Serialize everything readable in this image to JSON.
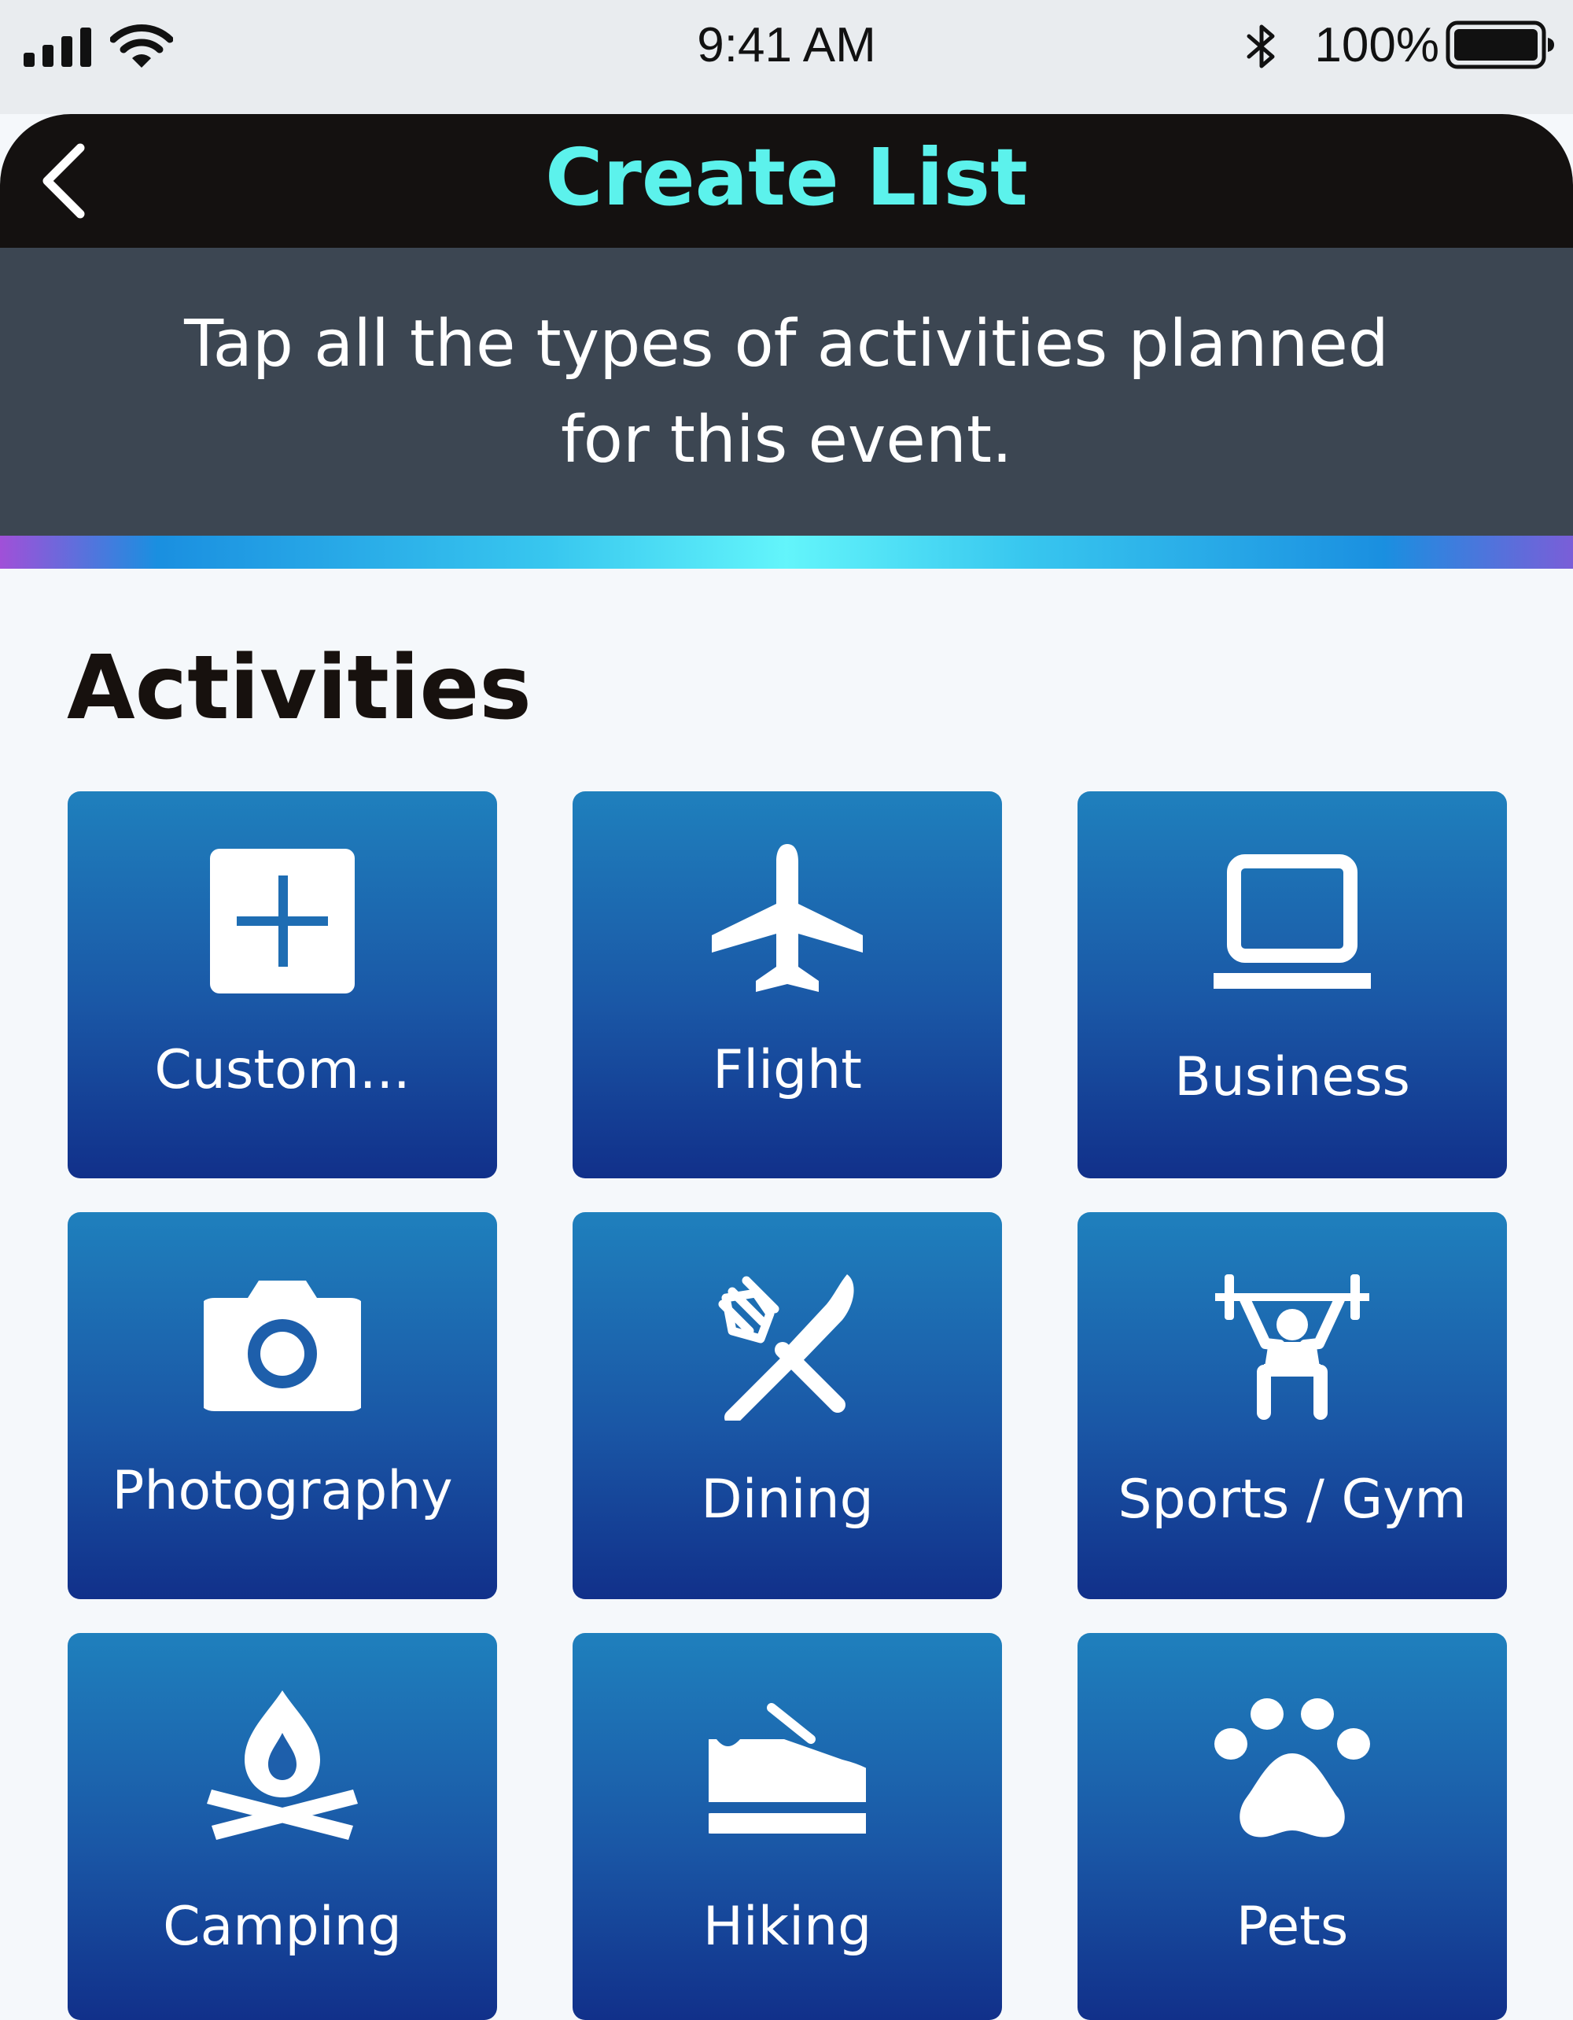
{
  "status_bar": {
    "time": "9:41 AM",
    "battery_percent": "100%",
    "icons": [
      "signal-icon",
      "wifi-icon",
      "bluetooth-icon",
      "battery-icon"
    ]
  },
  "nav": {
    "title": "Create List",
    "back_icon": "chevron-left-icon"
  },
  "instruction": {
    "line1": "Tap all the types of activities planned",
    "line2": "for this event."
  },
  "section": {
    "heading": "Activities"
  },
  "activities": [
    {
      "label": "Custom...",
      "icon": "plus-square-icon"
    },
    {
      "label": "Flight",
      "icon": "airplane-icon"
    },
    {
      "label": "Business",
      "icon": "laptop-icon"
    },
    {
      "label": "Photography",
      "icon": "camera-icon"
    },
    {
      "label": "Dining",
      "icon": "fork-knife-icon"
    },
    {
      "label": "Sports / Gym",
      "icon": "weightlifter-icon"
    },
    {
      "label": "Camping",
      "icon": "campfire-icon"
    },
    {
      "label": "Hiking",
      "icon": "shoe-icon"
    },
    {
      "label": "Pets",
      "icon": "paw-icon"
    }
  ],
  "colors": {
    "title_accent": "#5cf2ec",
    "nav_background": "#141110",
    "banner_background": "#3c4652",
    "tile_top": "#1f80bd",
    "tile_bottom": "#11308a"
  }
}
